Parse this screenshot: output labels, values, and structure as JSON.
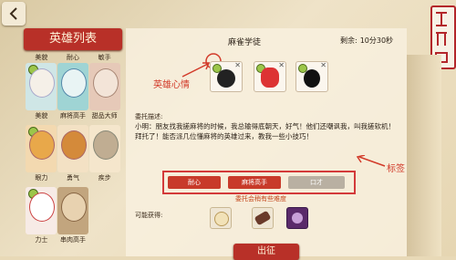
{
  "sidebar": {
    "title": "英雄列表",
    "top_row_tags": [
      "美貌",
      "耐心",
      "敏手"
    ],
    "heroes": [
      {
        "tags": [
          "美貌",
          "麻将高手",
          "甜品大师"
        ]
      },
      {
        "tags": [
          "眼力",
          "勇气",
          "疾步"
        ]
      },
      {
        "tags": [
          "力士",
          "串肉高手",
          ""
        ]
      }
    ]
  },
  "quest": {
    "title": "麻雀学徒",
    "time_label": "剩余:",
    "time_value": "10分30秒",
    "desc_label": "委托描述:",
    "desc_text": "小明：朋友找我搓麻将的时候，我总输得底朝天，好气！他们还嘲讽我，叫我搓软机！拜托了！能否派几位懂麻将的英雄过来，教我一些小技巧！",
    "tags": [
      "耐心",
      "麻将高手",
      "口才"
    ],
    "difficulty": "委托会稍有些难度",
    "rewards_label": "可能获得:",
    "go_button": "出征"
  },
  "annotations": {
    "mood": "英雄心情",
    "tag": "标签"
  },
  "colors": {
    "accent_red": "#b83028",
    "annot_red": "#d23b2a",
    "tag_grey": "#b9b0a2"
  }
}
